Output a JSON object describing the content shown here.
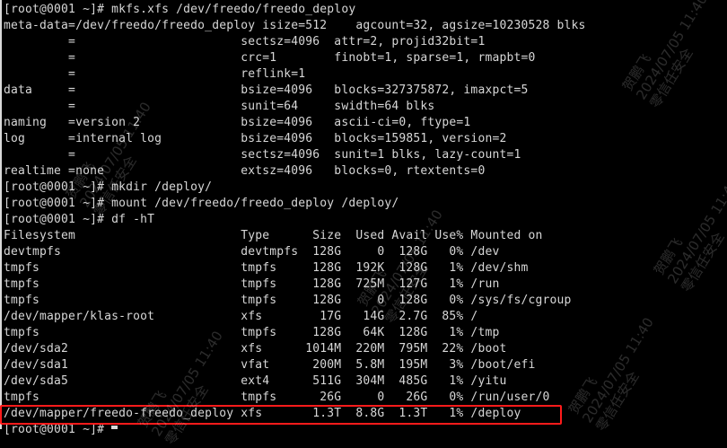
{
  "terminal": {
    "lines": [
      "[root@0001 ~]# mkfs.xfs /dev/freedo/freedo_deploy",
      "meta-data=/dev/freedo/freedo_deploy isize=512    agcount=32, agsize=10230528 blks",
      "         =                       sectsz=4096  attr=2, projid32bit=1",
      "         =                       crc=1        finobt=1, sparse=1, rmapbt=0",
      "         =                       reflink=1",
      "data     =                       bsize=4096   blocks=327375872, imaxpct=5",
      "         =                       sunit=64     swidth=64 blks",
      "naming   =version 2              bsize=4096   ascii-ci=0, ftype=1",
      "log      =internal log           bsize=4096   blocks=159851, version=2",
      "         =                       sectsz=4096  sunit=1 blks, lazy-count=1",
      "realtime =none                   extsz=4096   blocks=0, rtextents=0",
      "[root@0001 ~]# mkdir /deploy/",
      "[root@0001 ~]# mount /dev/freedo/freedo_deploy /deploy/",
      "[root@0001 ~]# df -hT",
      "Filesystem                       Type      Size  Used Avail Use% Mounted on",
      "devtmpfs                         devtmpfs  128G     0  128G   0% /dev",
      "tmpfs                            tmpfs     128G  192K  128G   1% /dev/shm",
      "tmpfs                            tmpfs     128G  725M  127G   1% /run",
      "tmpfs                            tmpfs     128G     0  128G   0% /sys/fs/cgroup",
      "/dev/mapper/klas-root            xfs        17G   14G  2.7G  85% /",
      "tmpfs                            tmpfs     128G   64K  128G   1% /tmp",
      "/dev/sda2                        xfs      1014M  220M  795M  22% /boot",
      "/dev/sda1                        vfat      200M  5.8M  195M   3% /boot/efi",
      "/dev/sda5                        ext4      511G  304M  485G   1% /yitu",
      "tmpfs                            tmpfs      26G     0   26G   0% /run/user/0",
      "/dev/mapper/freedo-freedo_deploy xfs       1.3T  8.8G  1.3T   1% /deploy",
      "[root@0001 ~]# "
    ]
  },
  "watermark": {
    "name": "贺鹏飞",
    "date": "2024/07/05 11:40",
    "org": "零信任安全"
  },
  "colors": {
    "background": "#000000",
    "text": "#d7d7d7",
    "highlight_border": "#ff1b1b"
  }
}
